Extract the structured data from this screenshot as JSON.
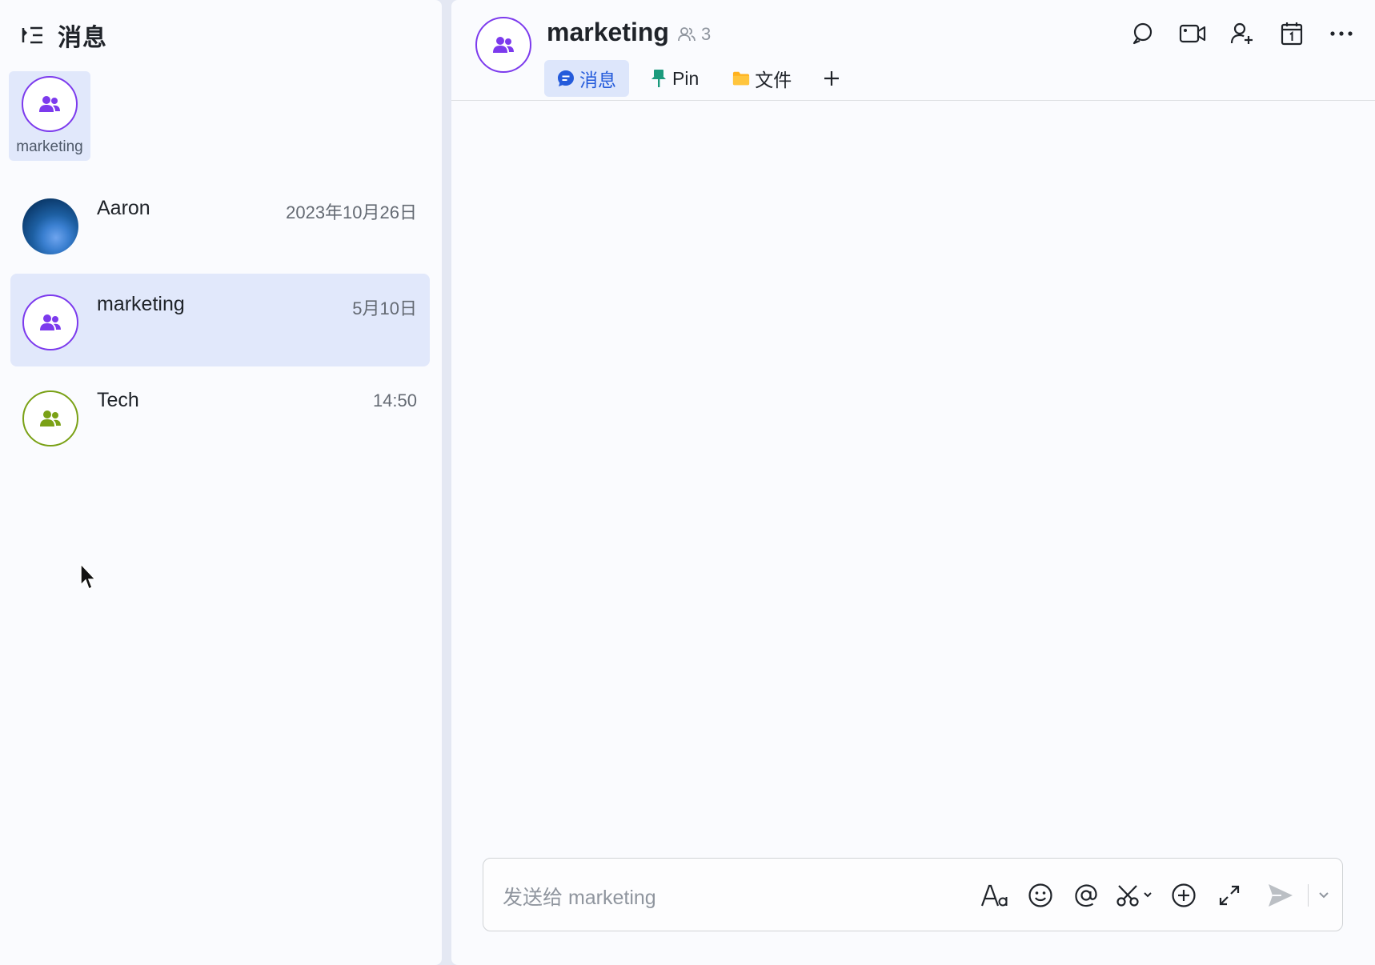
{
  "sidebar": {
    "title": "消息",
    "pinned": {
      "label": "marketing"
    },
    "chats": [
      {
        "name": "Aaron",
        "time": "2023年10月26日"
      },
      {
        "name": "marketing",
        "time": "5月10日"
      },
      {
        "name": "Tech",
        "time": "14:50"
      }
    ]
  },
  "main": {
    "title": "marketing",
    "member_count": "3",
    "tabs": [
      {
        "label": "消息"
      },
      {
        "label": "Pin"
      },
      {
        "label": "文件"
      }
    ],
    "composer": {
      "placeholder": "发送给 marketing"
    }
  },
  "colors": {
    "accent": "#245bdb",
    "group_avatar_purple": "#7c3aed",
    "group_avatar_green": "#7aa116",
    "active_row": "#e1e8fb"
  },
  "icons": {
    "sidebar": [
      "collapse-sidebar-icon",
      "group-icon"
    ],
    "header": [
      "search-icon",
      "video-call-icon",
      "add-member-icon",
      "calendar-icon",
      "more-icon"
    ],
    "tabs": [
      "chat-bubble-icon",
      "pin-icon",
      "folder-icon",
      "plus-icon"
    ],
    "composer": [
      "text-format-icon",
      "emoji-icon",
      "mention-icon",
      "screenshot-icon",
      "add-circle-icon",
      "expand-icon",
      "send-icon",
      "chevron-down-icon"
    ]
  }
}
